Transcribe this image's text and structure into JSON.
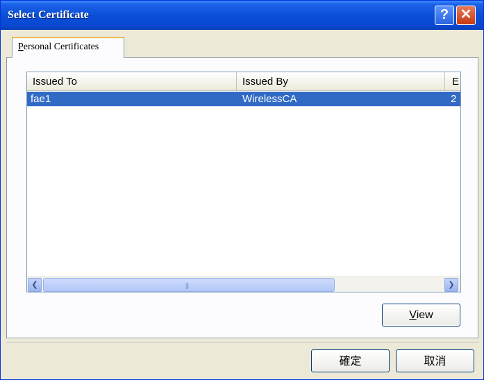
{
  "window": {
    "title": "Select Certificate",
    "help_label": "?",
    "close_label": "✕"
  },
  "tabs": [
    {
      "label_first": "P",
      "label_rest": "ersonal Certificates"
    }
  ],
  "table": {
    "columns": [
      "Issued To",
      "Issued By",
      "E"
    ],
    "rows": [
      {
        "issued_to": "fae1",
        "issued_by": "WirelessCA",
        "expiration": "2"
      }
    ]
  },
  "scrollbar": {
    "left_arrow": "❮",
    "right_arrow": "❯",
    "grip": "|||"
  },
  "buttons": {
    "view_first": "V",
    "view_rest": "iew",
    "ok": "確定",
    "cancel": "取消"
  },
  "colors": {
    "titlebar": "#0a4fd8",
    "selection": "#316ac5",
    "dialog_bg": "#ece9d8"
  }
}
